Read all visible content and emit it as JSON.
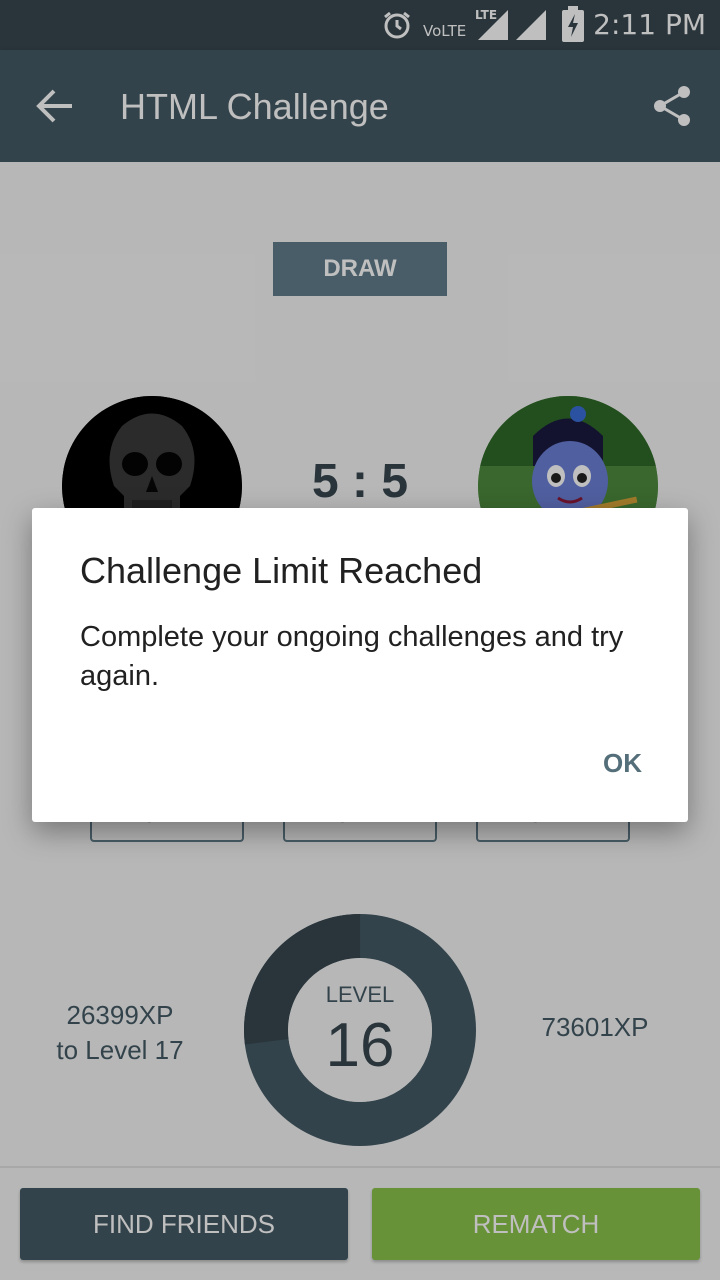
{
  "status_bar": {
    "time": "2:11 PM",
    "network_label": "VoLTE",
    "lte_label": "LTE"
  },
  "app_bar": {
    "title": "HTML Challenge"
  },
  "result": {
    "badge": "DRAW",
    "score": "5 : 5"
  },
  "players": {
    "left_avatar": "skull-avatar",
    "right_avatar": "character-avatar"
  },
  "xp_boxes": [
    "0 XP",
    "0 XP",
    "0 XP"
  ],
  "level": {
    "label": "LEVEL",
    "number": "16",
    "xp_to_next": "26399XP",
    "to_next_label": "to Level 17",
    "xp_total": "73601XP",
    "progress": 0.27
  },
  "buttons": {
    "find_friends": "FIND FRIENDS",
    "rematch": "REMATCH"
  },
  "dialog": {
    "title": "Challenge Limit Reached",
    "message": "Complete your ongoing challenges and try again.",
    "ok": "OK"
  }
}
